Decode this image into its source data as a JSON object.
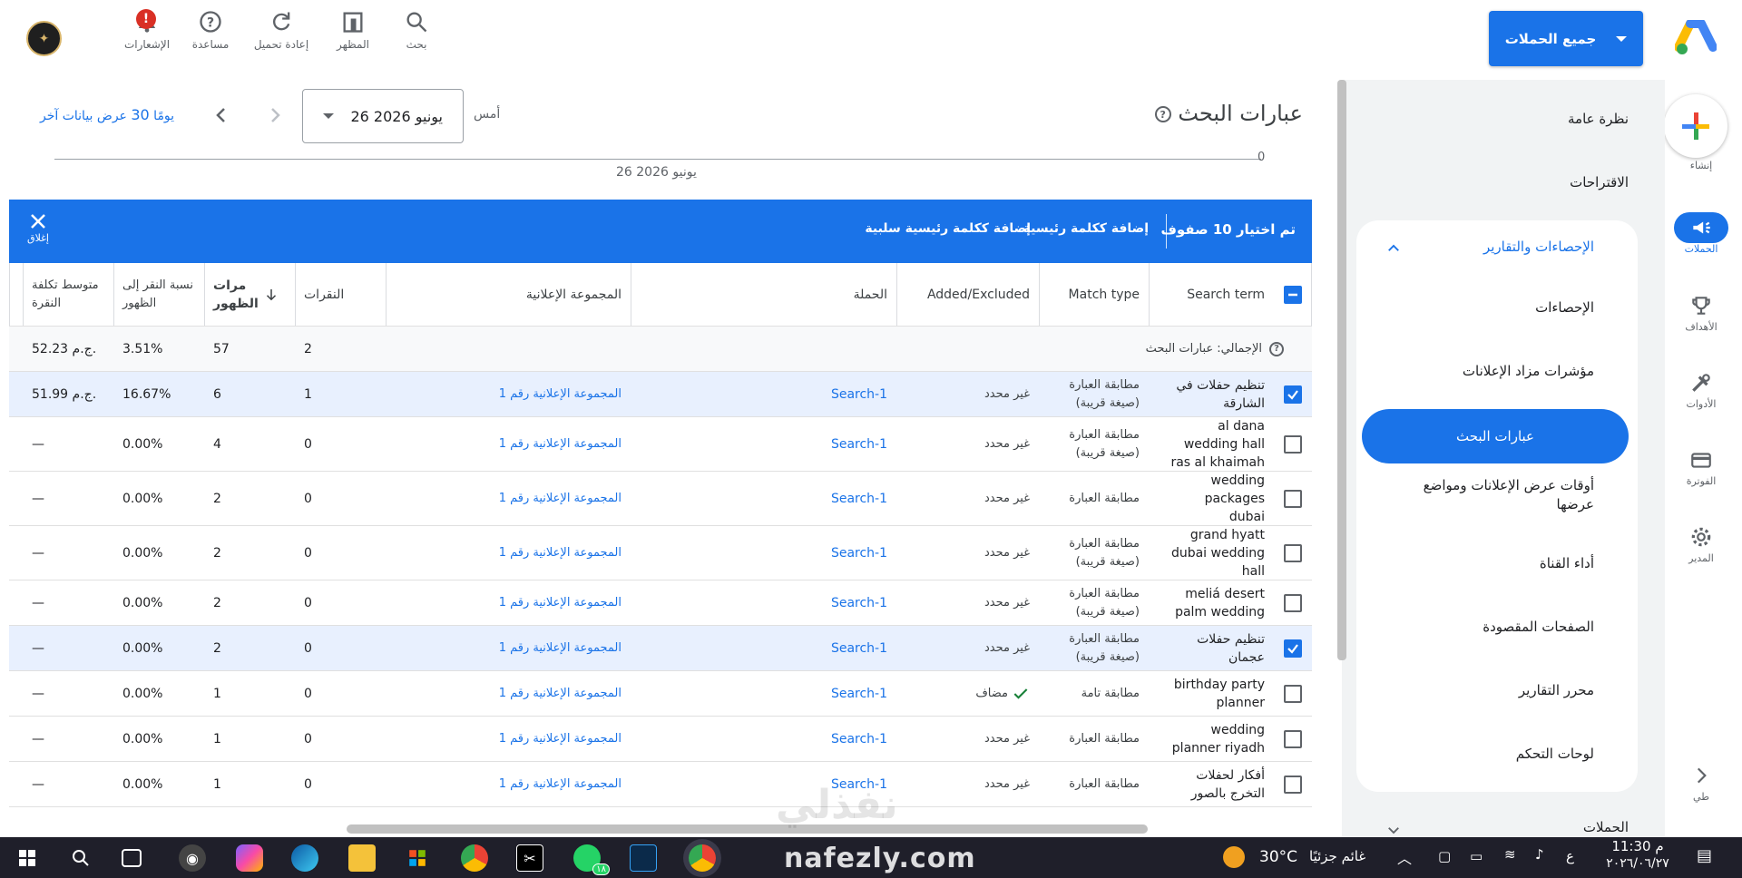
{
  "topbar": {
    "campaign_selector": "جميع الحملات",
    "tools": [
      {
        "label": "بحث",
        "icon": "search-icon"
      },
      {
        "label": "المظهر",
        "icon": "appearance-icon"
      },
      {
        "label": "إعادة تحميل",
        "icon": "refresh-icon"
      },
      {
        "label": "مساعدة",
        "icon": "help-icon"
      },
      {
        "label": "الإشعارات",
        "icon": "bell-icon",
        "badge": "!"
      }
    ]
  },
  "rail": {
    "create": "إنشاء",
    "items": [
      {
        "label": "الحملات",
        "icon": "megaphone-icon",
        "active": true
      },
      {
        "label": "الأهداف",
        "icon": "trophy-icon"
      },
      {
        "label": "الأدوات",
        "icon": "tools-icon"
      },
      {
        "label": "الفوترة",
        "icon": "billing-icon"
      },
      {
        "label": "المدير",
        "icon": "gear-icon"
      },
      {
        "label": "طي",
        "icon": "chevron-right-icon"
      }
    ]
  },
  "sidebar": {
    "overview": "نظرة عامة",
    "recommendations": "الاقتراحات",
    "section_title": "الإحصاءات والتقارير",
    "items": [
      {
        "label": "الإحصاءات"
      },
      {
        "label": "مؤشرات مزاد الإعلانات"
      },
      {
        "label": "عبارات البحث",
        "active": true
      },
      {
        "label": "أوقات عرض الإعلانات ومواضع عرضها"
      },
      {
        "label": "أداء القناة"
      },
      {
        "label": "الصفحات المقصودة"
      },
      {
        "label": "محرر التقارير"
      },
      {
        "label": "لوحات التحكم"
      }
    ],
    "next_section": "الحملات"
  },
  "page": {
    "title": "عبارات البحث",
    "date_label": "أمس",
    "date_value": "26 يونيو 2026",
    "last30_prefix": "عرض بيانات آخر",
    "last30_number": "30",
    "last30_suffix": "يومًا",
    "axis_zero": "0",
    "axis_date": "26 يونيو 2026"
  },
  "selection_bar": {
    "count_text": "تم اختيار 10 صفوف",
    "add_keyword": "إضافة ككلمة رئيسية",
    "add_negative": "إضافة ككلمة رئيسية سلبية",
    "close": "إغلاق"
  },
  "table": {
    "headers": {
      "search_term": "Search term",
      "match_type": "Match type",
      "added_excluded": "Added/Excluded",
      "campaign": "الحملة",
      "ad_group": "المجموعة الإعلانية",
      "clicks": "النقرات",
      "impr_line1": "مرات",
      "impr_line2": "الظهور",
      "ctr_line1": "نسبة النقر إلى",
      "ctr_line2": "الظهور",
      "cpc_line1": "متوسط تكلفة",
      "cpc_line2": "النقرة"
    },
    "total": {
      "label": "الإجمالي: عبارات البحث",
      "clicks": "2",
      "impr": "57",
      "ctr": "3.51%",
      "cpc": "52.23 ج.م."
    },
    "rows": [
      {
        "term": "تنظيم حفلات في الشارقة",
        "match": "مطابقة العبارة (صيغة قريبة)",
        "added": "غير محدد",
        "campaign": "Search-1",
        "adgroup": "المجموعة الإعلانية رقم 1",
        "clicks": "1",
        "impr": "6",
        "ctr": "16.67%",
        "cpc": "51.99 ج.م.",
        "checked": true
      },
      {
        "term": "al dana wedding hall ras al khaimah",
        "match": "مطابقة العبارة (صيغة قريبة)",
        "added": "غير محدد",
        "campaign": "Search-1",
        "adgroup": "المجموعة الإعلانية رقم 1",
        "clicks": "0",
        "impr": "4",
        "ctr": "0.00%",
        "cpc": "—",
        "checked": false
      },
      {
        "term": "wedding packages dubai",
        "match": "مطابقة العبارة",
        "added": "غير محدد",
        "campaign": "Search-1",
        "adgroup": "المجموعة الإعلانية رقم 1",
        "clicks": "0",
        "impr": "2",
        "ctr": "0.00%",
        "cpc": "—",
        "checked": false
      },
      {
        "term": "grand hyatt dubai wedding hall",
        "match": "مطابقة العبارة (صيغة قريبة)",
        "added": "غير محدد",
        "campaign": "Search-1",
        "adgroup": "المجموعة الإعلانية رقم 1",
        "clicks": "0",
        "impr": "2",
        "ctr": "0.00%",
        "cpc": "—",
        "checked": false
      },
      {
        "term": "meliá desert palm wedding",
        "match": "مطابقة العبارة (صيغة قريبة)",
        "added": "غير محدد",
        "campaign": "Search-1",
        "adgroup": "المجموعة الإعلانية رقم 1",
        "clicks": "0",
        "impr": "2",
        "ctr": "0.00%",
        "cpc": "—",
        "checked": false
      },
      {
        "term": "تنظيم حفلات عجمان",
        "match": "مطابقة العبارة (صيغة قريبة)",
        "added": "غير محدد",
        "campaign": "Search-1",
        "adgroup": "المجموعة الإعلانية رقم 1",
        "clicks": "0",
        "impr": "2",
        "ctr": "0.00%",
        "cpc": "—",
        "checked": true
      },
      {
        "term": "birthday party planner",
        "match": "مطابقة تامة",
        "added": "مضاف",
        "added_check": true,
        "campaign": "Search-1",
        "adgroup": "المجموعة الإعلانية رقم 1",
        "clicks": "0",
        "impr": "1",
        "ctr": "0.00%",
        "cpc": "—",
        "checked": false
      },
      {
        "term": "wedding planner riyadh",
        "match": "مطابقة العبارة",
        "added": "غير محدد",
        "campaign": "Search-1",
        "adgroup": "المجموعة الإعلانية رقم 1",
        "clicks": "0",
        "impr": "1",
        "ctr": "0.00%",
        "cpc": "—",
        "checked": false
      },
      {
        "term": "أفكار لحفلات التخرج بالصور",
        "match": "مطابقة العبارة",
        "added": "غير محدد",
        "campaign": "Search-1",
        "adgroup": "المجموعة الإعلانية رقم 1",
        "clicks": "0",
        "impr": "1",
        "ctr": "0.00%",
        "cpc": "—",
        "checked": false
      }
    ]
  },
  "watermark": {
    "arabic": "نفذلي",
    "latin": "nafezly.com"
  },
  "taskbar": {
    "weather_temp": "30°C",
    "weather_text": "غائم جزئيًا",
    "time": "11:30 م",
    "date": "٢٠٢٦/٠٦/٢٧",
    "lang": "ع",
    "whatsapp_badge": "١٨"
  },
  "colors": {
    "accent": "#1a73e8",
    "selected_row": "#e8f0fe",
    "taskbar": "#1f1f2a"
  }
}
